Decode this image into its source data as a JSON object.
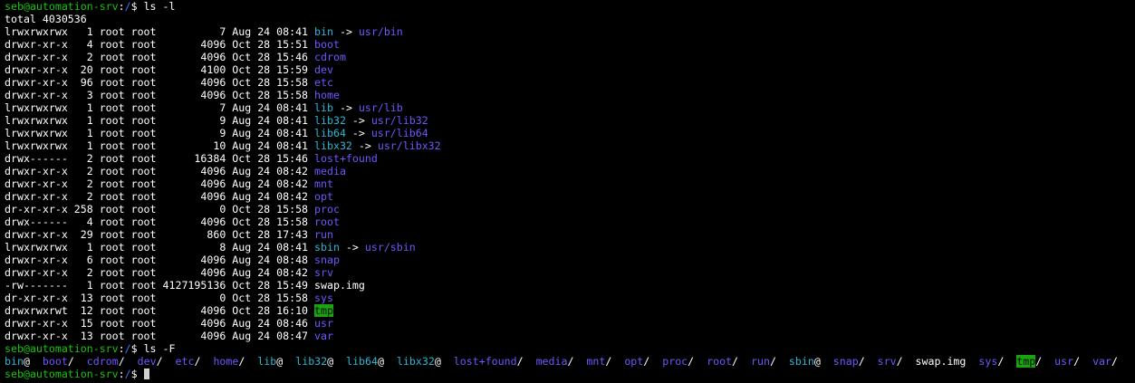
{
  "prompt": {
    "user_host": "seb@automation-srv",
    "sep": ":",
    "path": "/",
    "symbol": "$"
  },
  "commands": {
    "first": " ls -l",
    "second": " ls -F"
  },
  "total_line": "total 4030536",
  "listing": [
    {
      "meta": "lrwxrwxrwx   1 root root          7 Aug 24 08:41 ",
      "name": "bin",
      "type": "link",
      "target": "usr/bin"
    },
    {
      "meta": "drwxr-xr-x   4 root root       4096 Oct 28 15:51 ",
      "name": "boot",
      "type": "dir"
    },
    {
      "meta": "drwxr-xr-x   2 root root       4096 Oct 28 15:46 ",
      "name": "cdrom",
      "type": "dir"
    },
    {
      "meta": "drwxr-xr-x  20 root root       4100 Oct 28 15:59 ",
      "name": "dev",
      "type": "dir"
    },
    {
      "meta": "drwxr-xr-x  96 root root       4096 Oct 28 15:58 ",
      "name": "etc",
      "type": "dir"
    },
    {
      "meta": "drwxr-xr-x   3 root root       4096 Oct 28 15:58 ",
      "name": "home",
      "type": "dir"
    },
    {
      "meta": "lrwxrwxrwx   1 root root          7 Aug 24 08:41 ",
      "name": "lib",
      "type": "link",
      "target": "usr/lib"
    },
    {
      "meta": "lrwxrwxrwx   1 root root          9 Aug 24 08:41 ",
      "name": "lib32",
      "type": "link",
      "target": "usr/lib32"
    },
    {
      "meta": "lrwxrwxrwx   1 root root          9 Aug 24 08:41 ",
      "name": "lib64",
      "type": "link",
      "target": "usr/lib64"
    },
    {
      "meta": "lrwxrwxrwx   1 root root         10 Aug 24 08:41 ",
      "name": "libx32",
      "type": "link",
      "target": "usr/libx32"
    },
    {
      "meta": "drwx------   2 root root      16384 Oct 28 15:46 ",
      "name": "lost+found",
      "type": "dir"
    },
    {
      "meta": "drwxr-xr-x   2 root root       4096 Aug 24 08:42 ",
      "name": "media",
      "type": "dir"
    },
    {
      "meta": "drwxr-xr-x   2 root root       4096 Aug 24 08:42 ",
      "name": "mnt",
      "type": "dir"
    },
    {
      "meta": "drwxr-xr-x   2 root root       4096 Aug 24 08:42 ",
      "name": "opt",
      "type": "dir"
    },
    {
      "meta": "dr-xr-xr-x 258 root root          0 Oct 28 15:58 ",
      "name": "proc",
      "type": "dir"
    },
    {
      "meta": "drwx------   4 root root       4096 Oct 28 15:58 ",
      "name": "root",
      "type": "dir"
    },
    {
      "meta": "drwxr-xr-x  29 root root        860 Oct 28 17:43 ",
      "name": "run",
      "type": "dir"
    },
    {
      "meta": "lrwxrwxrwx   1 root root          8 Aug 24 08:41 ",
      "name": "sbin",
      "type": "link",
      "target": "usr/sbin"
    },
    {
      "meta": "drwxr-xr-x   6 root root       4096 Aug 24 08:48 ",
      "name": "snap",
      "type": "dir"
    },
    {
      "meta": "drwxr-xr-x   2 root root       4096 Aug 24 08:42 ",
      "name": "srv",
      "type": "dir"
    },
    {
      "meta": "-rw-------   1 root root 4127195136 Oct 28 15:49 ",
      "name": "swap.img",
      "type": "file"
    },
    {
      "meta": "dr-xr-xr-x  13 root root          0 Oct 28 15:58 ",
      "name": "sys",
      "type": "dir"
    },
    {
      "meta": "drwxrwxrwt  12 root root       4096 Oct 28 16:10 ",
      "name": "tmp",
      "type": "sticky"
    },
    {
      "meta": "drwxr-xr-x  15 root root       4096 Aug 24 08:46 ",
      "name": "usr",
      "type": "dir"
    },
    {
      "meta": "drwxr-xr-x  13 root root       4096 Aug 24 08:47 ",
      "name": "var",
      "type": "dir"
    }
  ],
  "arrow": " -> ",
  "ls_f": [
    {
      "name": "bin",
      "suffix": "@",
      "type": "link"
    },
    {
      "name": "boot",
      "suffix": "/",
      "type": "dir"
    },
    {
      "name": "cdrom",
      "suffix": "/",
      "type": "dir"
    },
    {
      "name": "dev",
      "suffix": "/",
      "type": "dir"
    },
    {
      "name": "etc",
      "suffix": "/",
      "type": "dir"
    },
    {
      "name": "home",
      "suffix": "/",
      "type": "dir"
    },
    {
      "name": "lib",
      "suffix": "@",
      "type": "link"
    },
    {
      "name": "lib32",
      "suffix": "@",
      "type": "link"
    },
    {
      "name": "lib64",
      "suffix": "@",
      "type": "link"
    },
    {
      "name": "libx32",
      "suffix": "@",
      "type": "link"
    },
    {
      "name": "lost+found",
      "suffix": "/",
      "type": "dir"
    },
    {
      "name": "media",
      "suffix": "/",
      "type": "dir"
    },
    {
      "name": "mnt",
      "suffix": "/",
      "type": "dir"
    },
    {
      "name": "opt",
      "suffix": "/",
      "type": "dir"
    },
    {
      "name": "proc",
      "suffix": "/",
      "type": "dir"
    },
    {
      "name": "root",
      "suffix": "/",
      "type": "dir"
    },
    {
      "name": "run",
      "suffix": "/",
      "type": "dir"
    },
    {
      "name": "sbin",
      "suffix": "@",
      "type": "link"
    },
    {
      "name": "snap",
      "suffix": "/",
      "type": "dir"
    },
    {
      "name": "srv",
      "suffix": "/",
      "type": "dir"
    },
    {
      "name": "swap.img",
      "suffix": "",
      "type": "file"
    },
    {
      "name": "sys",
      "suffix": "/",
      "type": "dir"
    },
    {
      "name": "tmp",
      "suffix": "/",
      "type": "sticky"
    },
    {
      "name": "usr",
      "suffix": "/",
      "type": "dir"
    },
    {
      "name": "var",
      "suffix": "/",
      "type": "dir"
    }
  ],
  "ls_f_gap": "  ",
  "colors": {
    "background": "#000000",
    "text": "#ffffff",
    "prompt_user": "#16c60c",
    "prompt_path": "#3b78ff",
    "directory": "#6f56ff",
    "symlink": "#2ab7d4",
    "sticky_bg": "#18a30f"
  }
}
